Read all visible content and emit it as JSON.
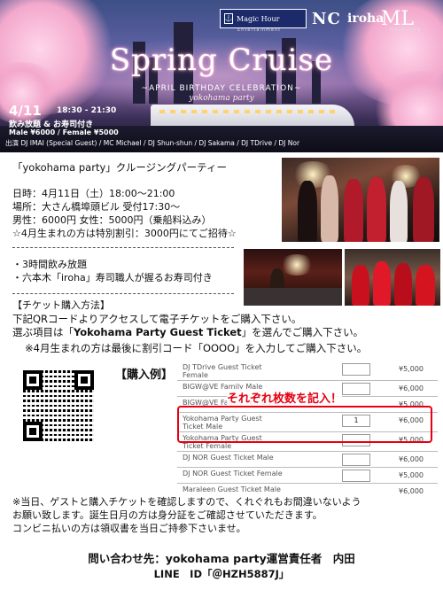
{
  "hero": {
    "logos": {
      "magic_hour": "Magic Hour",
      "magic_hour_sub": "Entertainment",
      "nc": "NC",
      "iroha": "iroha",
      "maraleen": "ML",
      "maraleen_sub": "MARALEEN"
    },
    "title": "Spring Cruise",
    "subtitle": "~APRIL BIRTHDAY CELEBRATION~",
    "tagline": "yokohama party",
    "date": "4/11",
    "time": "18:30 - 21:30",
    "drinks": "飲み放題 & お寿司付き",
    "prices": "Male ¥6000 / Female ¥5000",
    "djs": "出演 DJ IMAI (Special Guest) / MC Michael / DJ Shun-shun / DJ Sakama / DJ TDrive / DJ Nor"
  },
  "body": {
    "lead": "「yokohama party」クルージングパーティー",
    "info_date": "日時：4月11日（土）18:00～21:00",
    "info_place": "場所：大さん橋埠頭ビル 受付17:30～",
    "info_price": "男性：6000円 女性：5000円（乗船料込み）",
    "info_birthday": "☆4月生まれの方は特別割引：3000円にてご招待☆",
    "bullet_drinks": "・3時間飲み放題",
    "bullet_sushi": "・六本木「iroha」寿司職人が握るお寿司付き",
    "ticket_heading": "【チケット購入方法】",
    "instr1": "下記QRコードよりアクセスして電子チケットをご購入下さい。",
    "instr2_pre": "選ぶ項目は「",
    "instr2_bold": "Yokohama Party Guest Ticket",
    "instr2_post": "」を選んでご購入下さい。",
    "instr3": "※4月生まれの方は最後に割引コード「OOOO」を入力してご購入下さい。"
  },
  "example": {
    "label": "【購入例】",
    "highlight_text": "それぞれ枚数を記入！",
    "rows": [
      {
        "name": "DJ TDrive Guest Ticket\nFemale",
        "qty": "",
        "price": "¥5,000"
      },
      {
        "name": "BIGW@VE Family Male",
        "qty": "",
        "price": "¥6,000"
      },
      {
        "name": "BIGW@VE Family Female",
        "qty": "",
        "price": "¥5,000"
      },
      {
        "name": "Yokohama Party Guest\nTicket Male",
        "qty": "1",
        "price": "¥6,000"
      },
      {
        "name": "Yokohama Party Guest\nTicket Female",
        "qty": "",
        "price": "¥5,000"
      },
      {
        "name": "DJ NOR Guest Ticket Male",
        "qty": "",
        "price": "¥6,000"
      },
      {
        "name": "DJ NOR Guest Ticket Female",
        "qty": "",
        "price": "¥5,000"
      },
      {
        "name": "Maraleen Guest Ticket Male",
        "qty": "",
        "price": "¥6,000"
      }
    ]
  },
  "notes": {
    "n1": "※当日、ゲストと購入チケットを確認しますので、くれぐれもお間違いないよう",
    "n2": "お願い致します。誕生日月の方は身分証をご確認させていただきます。",
    "n3": "コンビニ払いの方は領収書を当日ご持参下さいませ。"
  },
  "contact": {
    "inquiry": "問い合わせ先：yokohama party運営責任者　内田",
    "line": "LINE　ID「＠HZH5887J」"
  }
}
